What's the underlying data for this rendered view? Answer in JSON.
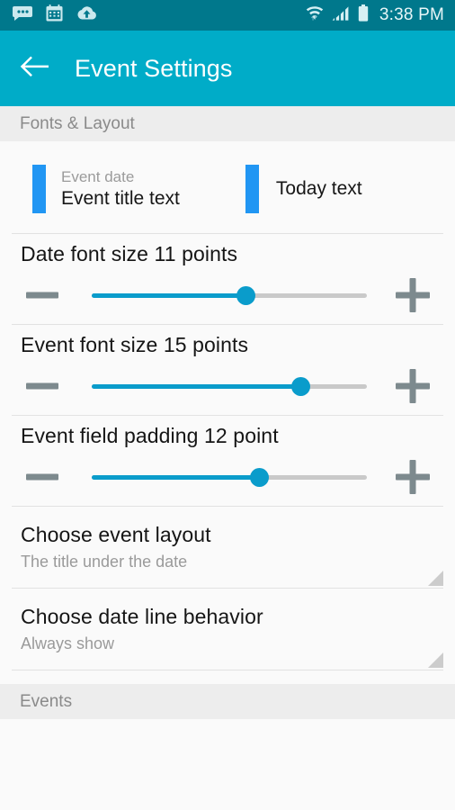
{
  "status_bar": {
    "icons": [
      "messages-icon",
      "calendar-icon",
      "cloud-upload-icon"
    ],
    "right_icons": [
      "wifi-icon",
      "cellular-signal-icon",
      "battery-icon"
    ],
    "time": "3:38 PM",
    "background_color": "#00788c"
  },
  "app_bar": {
    "back_icon": "back-arrow-icon",
    "title": "Event Settings",
    "background_color": "#00acc8"
  },
  "sections": {
    "fonts_layout_header": "Fonts & Layout",
    "events_header": "Events"
  },
  "preview": {
    "bar_color": "#2196f3",
    "event": {
      "date_label": "Event date",
      "title_label": "Event title text"
    },
    "today": {
      "label": "Today text"
    }
  },
  "sliders": [
    {
      "label": "Date font size 11 points",
      "setting": "Date font size",
      "value": 11,
      "unit": "points",
      "percent": 56,
      "decrement_icon": "minus-icon",
      "increment_icon": "plus-icon",
      "fill_color": "#0a9ccb",
      "track_color": "#c9c9c9"
    },
    {
      "label": "Event font size 15 points",
      "setting": "Event font size",
      "value": 15,
      "unit": "points",
      "percent": 76,
      "decrement_icon": "minus-icon",
      "increment_icon": "plus-icon",
      "fill_color": "#0a9ccb",
      "track_color": "#c9c9c9"
    },
    {
      "label": "Event field padding 12 point",
      "setting": "Event field padding",
      "value": 12,
      "unit": "point",
      "percent": 61,
      "decrement_icon": "minus-icon",
      "increment_icon": "plus-icon",
      "fill_color": "#0a9ccb",
      "track_color": "#c9c9c9"
    }
  ],
  "preferences": [
    {
      "title": "Choose event layout",
      "summary": "The title under the date"
    },
    {
      "title": "Choose date line behavior",
      "summary": "Always show"
    }
  ]
}
